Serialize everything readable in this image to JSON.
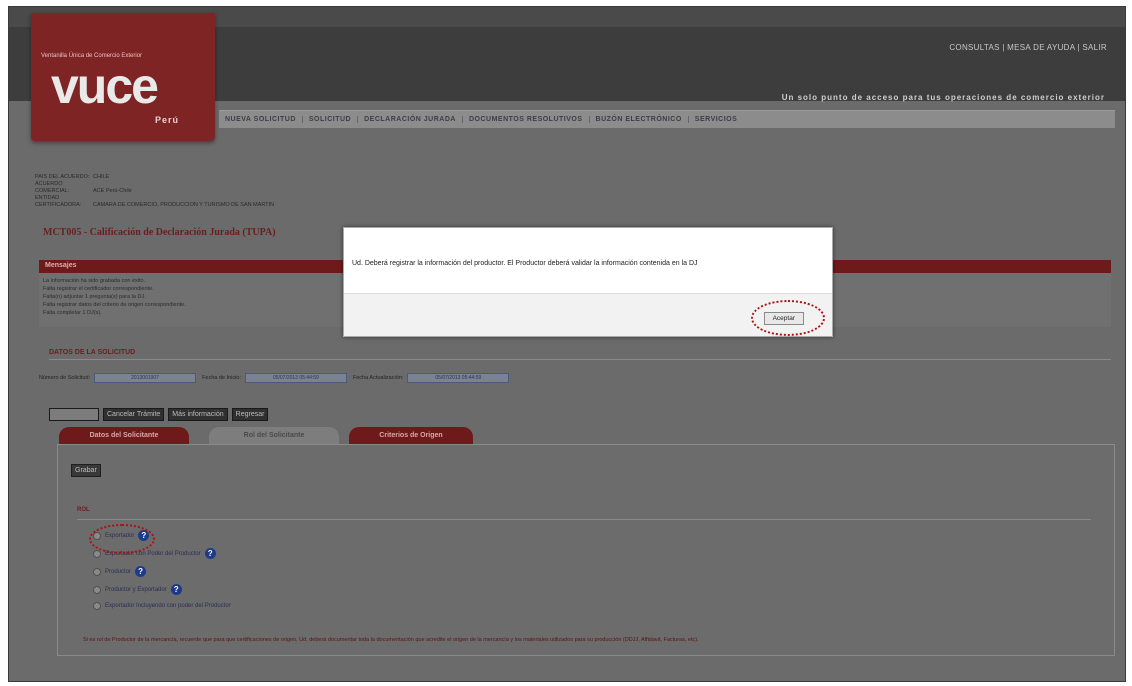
{
  "header": {
    "top_links": "CONSULTAS | MESA DE AYUDA | SALIR",
    "tagline": "Un solo punto de acceso para tus operaciones de comercio exterior",
    "logo": {
      "small_text": "Ventanilla Única de Comercio Exterior",
      "main_text": "vuce",
      "country": "Perú"
    },
    "nav": [
      "NUEVA SOLICITUD",
      "SOLICITUD",
      "DECLARACIÓN JURADA",
      "DOCUMENTOS RESOLUTIVOS",
      "BUZÓN ELECTRÓNICO",
      "SERVICIOS"
    ]
  },
  "info": [
    {
      "label": "PAIS DEL ACUERDO:",
      "value": "CHILE"
    },
    {
      "label": "ACUERDO COMERCIAL:",
      "value": "ACE Perú-Chile"
    },
    {
      "label": "ENTIDAD CERTIFICADORA:",
      "value": "CAMARA DE COMERCIO, PRODUCCION Y TURISMO DE SAN MARTIN"
    }
  ],
  "page_title": "MCT005 - Calificación de Declaración Jurada (TUPA)",
  "messages": {
    "title": "Mensajes",
    "lines": [
      "La información ha sido grabada con éxito.",
      "Falta registrar el certificador correspondiente.",
      "Falta(n) adjuntar 1 pregunta(s) para la DJ.",
      "Falta registrar datos del criterio de origen correspondiente.",
      "Falta completar 1 DJ(s)."
    ]
  },
  "solicitud": {
    "title": "DATOS DE LA SOLICITUD",
    "fields": [
      {
        "label": "Número de Solicitud:",
        "value": "2013001907"
      },
      {
        "label": "Fecha de Inicio:",
        "value": "05/07/2013 05:44:59"
      },
      {
        "label": "Fecha Actualización:",
        "value": "05/07/2013 05:44:59"
      }
    ]
  },
  "buttons": {
    "first": "Adjuntar",
    "cancel": "Cancelar Trámite",
    "info": "Más información",
    "back": "Regresar",
    "save": "Grabar"
  },
  "tabs": [
    "Datos del Solicitante",
    "Rol del Solicitante",
    "Criterios de Origen"
  ],
  "rol": {
    "label": "ROL",
    "options": [
      "Exportador",
      "Exportador con Poder del Productor",
      "Productor",
      "Productor y Exportador",
      "Exportador Incluyendo con poder del Productor"
    ]
  },
  "footer_note": "Si es rol de Productor de la mercancía, recuerde que para que certificaciones de origen, Ud. deberá documentar toda la documentación que acredite el origen de la mercancía y los materiales utilizados para su producción (DDJJ, Affidavit, Facturas, etc).",
  "modal": {
    "message": "Ud. Deberá registrar la información del productor. El Productor deberá validar la información contenida en la DJ",
    "accept": "Aceptar"
  }
}
